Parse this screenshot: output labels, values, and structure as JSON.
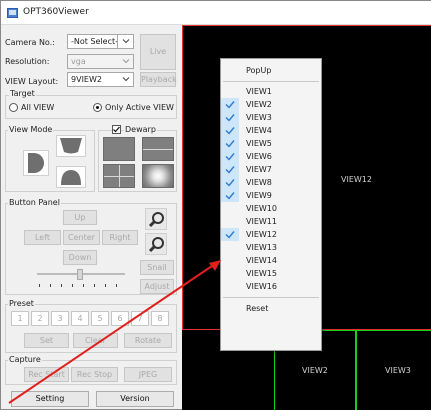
{
  "app": {
    "title": "OPT360Viewer"
  },
  "camera": {
    "label": "Camera No.:",
    "value": "-Not Select-",
    "live_label": "Live"
  },
  "resolution": {
    "label": "Resolution:",
    "value": "vga"
  },
  "layout": {
    "label": "VIEW Layout:",
    "value": "9VIEW2",
    "playback_label": "Playback"
  },
  "target": {
    "title": "Target",
    "all_view": "All VIEW",
    "only_active": "Only Active VIEW",
    "selected": "only_active"
  },
  "view_mode": {
    "title": "View Mode",
    "dewarp_label": "Dewarp",
    "dewarp_checked": true
  },
  "button_panel": {
    "title": "Button Panel",
    "up": "Up",
    "left": "Left",
    "center": "Center",
    "right": "Right",
    "down": "Down",
    "snail": "Snail",
    "adjust": "Adjust"
  },
  "preset": {
    "title": "Preset",
    "numbers": [
      "1",
      "2",
      "3",
      "4",
      "5",
      "6",
      "7",
      "8"
    ],
    "set": "Set",
    "clear": "Clear",
    "rotate": "Rotate"
  },
  "capture": {
    "title": "Capture",
    "rec_start": "Rec Start",
    "rec_stop": "Rec Stop",
    "jpeg": "JPEG"
  },
  "bottom": {
    "setting": "Setting",
    "version": "Version"
  },
  "views": {
    "main": "VIEW12",
    "small_left": "VIEW2",
    "small_right": "VIEW3"
  },
  "popup_menu": {
    "header": "PopUp",
    "items": [
      {
        "label": "VIEW1",
        "checked": false
      },
      {
        "label": "VIEW2",
        "checked": true
      },
      {
        "label": "VIEW3",
        "checked": true
      },
      {
        "label": "VIEW4",
        "checked": true
      },
      {
        "label": "VIEW5",
        "checked": true
      },
      {
        "label": "VIEW6",
        "checked": true
      },
      {
        "label": "VIEW7",
        "checked": true
      },
      {
        "label": "VIEW8",
        "checked": true
      },
      {
        "label": "VIEW9",
        "checked": true
      },
      {
        "label": "VIEW10",
        "checked": false
      },
      {
        "label": "VIEW11",
        "checked": false
      },
      {
        "label": "VIEW12",
        "checked": true
      },
      {
        "label": "VIEW13",
        "checked": false
      },
      {
        "label": "VIEW14",
        "checked": false
      },
      {
        "label": "VIEW15",
        "checked": false
      },
      {
        "label": "VIEW16",
        "checked": false
      }
    ],
    "reset": "Reset"
  },
  "colors": {
    "active_view_border": "#e23030",
    "inactive_view_border": "#19d019",
    "menu_check": "#2f7bd6",
    "annotation_arrow": "#e0201c"
  }
}
